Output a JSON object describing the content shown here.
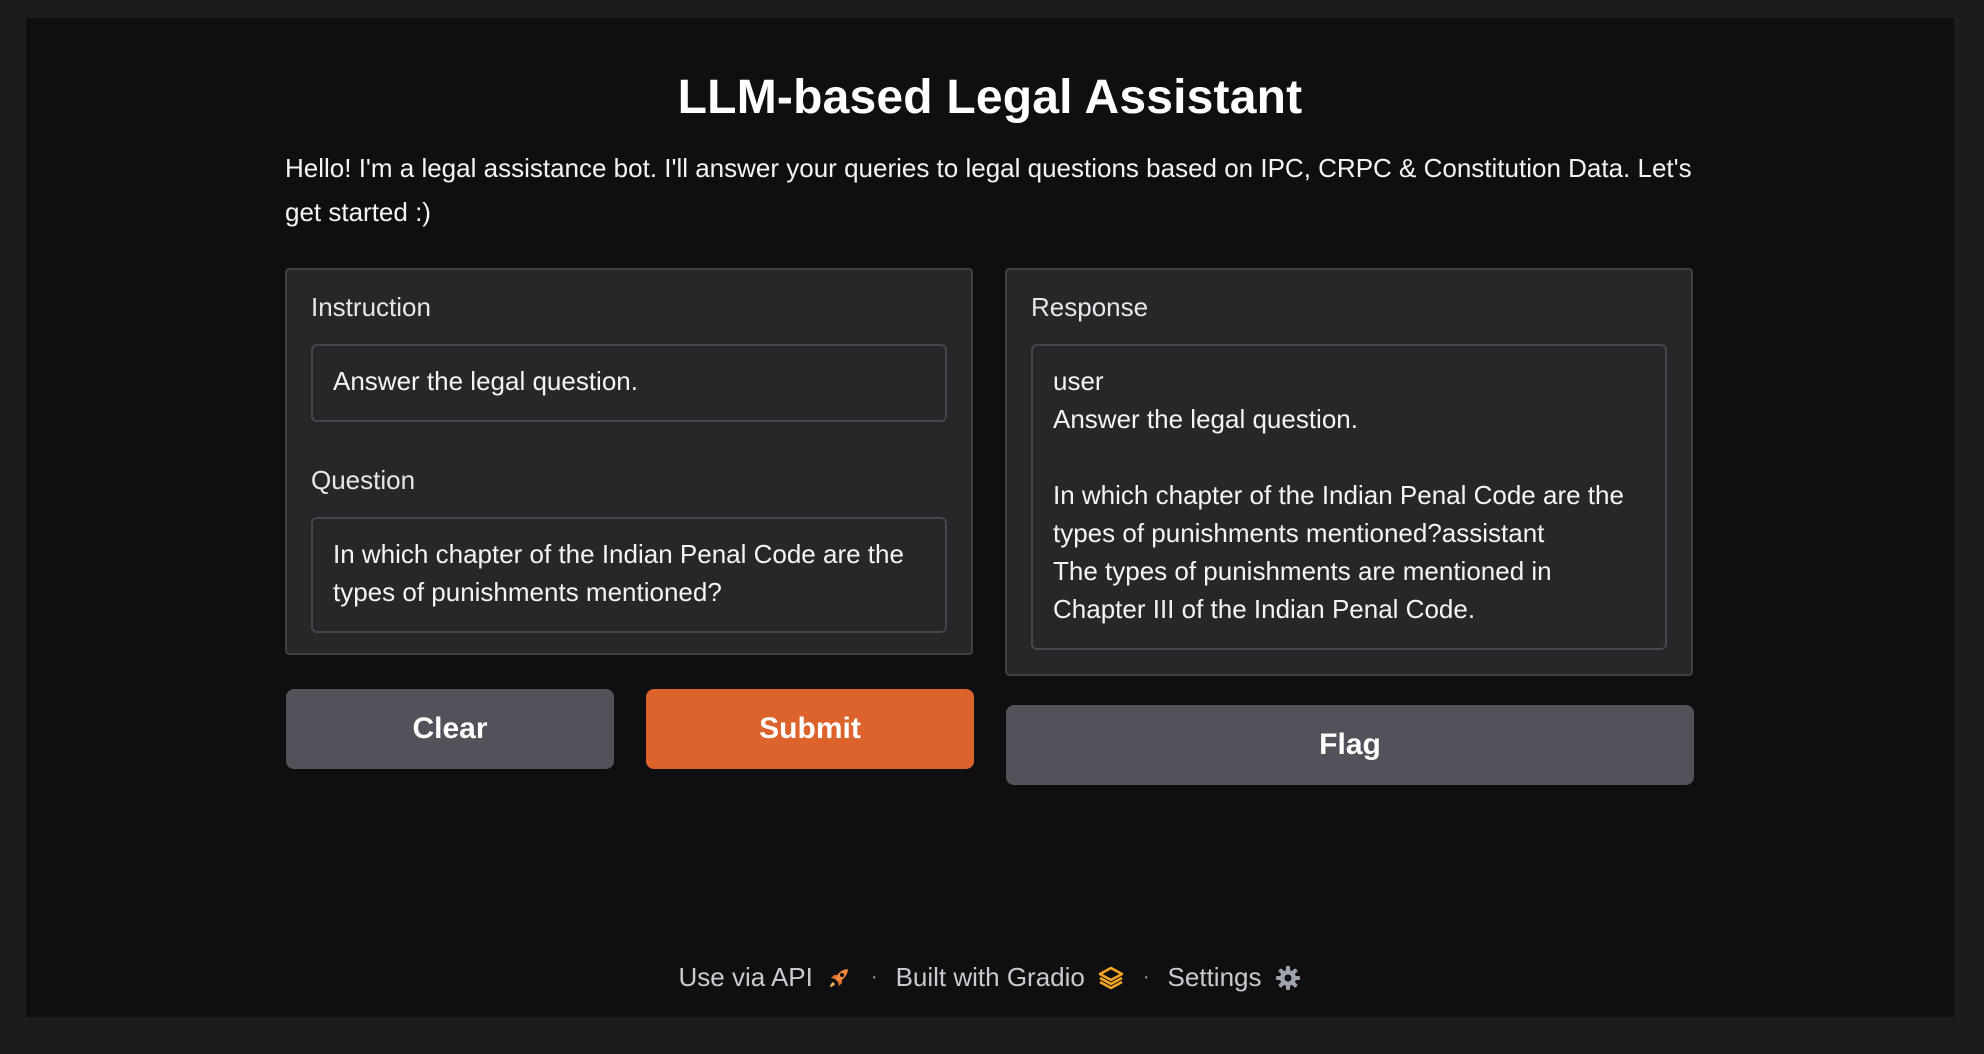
{
  "header": {
    "title": "LLM-based Legal Assistant",
    "description": "Hello! I'm a legal assistance bot. I'll answer your queries to legal questions based on IPC, CRPC & Constitution Data. Let's get started :)"
  },
  "inputs": {
    "instruction": {
      "label": "Instruction",
      "value": "Answer the legal question."
    },
    "question": {
      "label": "Question",
      "value": "In which chapter of the Indian Penal Code are the types of punishments mentioned?"
    }
  },
  "output": {
    "label": "Response",
    "value": "user\nAnswer the legal question.\n\nIn which chapter of the Indian Penal Code are the types of punishments mentioned?assistant\nThe types of punishments are mentioned in Chapter III of the Indian Penal Code."
  },
  "buttons": {
    "clear": "Clear",
    "submit": "Submit",
    "flag": "Flag"
  },
  "footer": {
    "api": "Use via API",
    "built_with": "Built with Gradio",
    "settings": "Settings",
    "separator": "·",
    "icons": [
      "rocket-icon",
      "gradio-logo-icon",
      "gear-icon"
    ]
  },
  "colors": {
    "background": "#0f0f11",
    "panel": "#27272a",
    "primary": "#dd632c",
    "secondary": "#52525b"
  }
}
